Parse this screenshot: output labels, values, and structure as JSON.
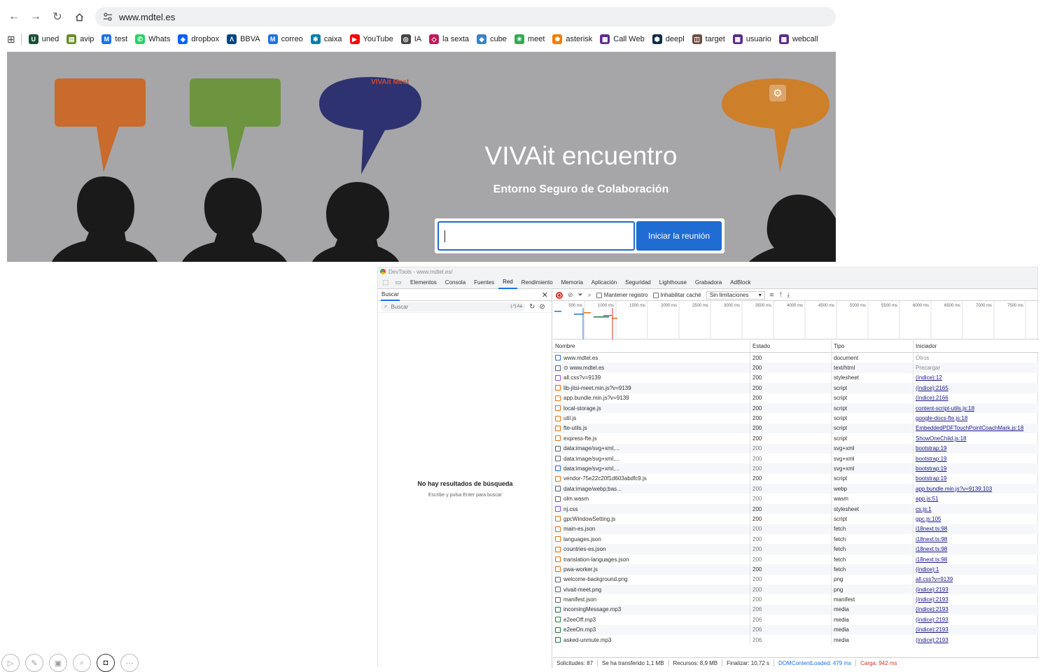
{
  "browser": {
    "url": "www.mdtel.es",
    "bookmarks": [
      {
        "label": "uned",
        "icon": "U",
        "color": "#1a4f35"
      },
      {
        "label": "avip",
        "icon": "▤",
        "color": "#6b8e23"
      },
      {
        "label": "test",
        "icon": "M",
        "color": "#1a73e8"
      },
      {
        "label": "Whats",
        "icon": "✆",
        "color": "#25d366"
      },
      {
        "label": "dropbox",
        "icon": "◈",
        "color": "#0061ff"
      },
      {
        "label": "BBVA",
        "icon": "Λ",
        "color": "#004481"
      },
      {
        "label": "correo",
        "icon": "M",
        "color": "#1a73e8"
      },
      {
        "label": "caixa",
        "icon": "✱",
        "color": "#007eae"
      },
      {
        "label": "YouTube",
        "icon": "▶",
        "color": "#ff0000"
      },
      {
        "label": "IA",
        "icon": "◎",
        "color": "#444444"
      },
      {
        "label": "la sexta",
        "icon": "◇",
        "color": "#c2185b"
      },
      {
        "label": "cube",
        "icon": "◆",
        "color": "#3b82c4"
      },
      {
        "label": "meet",
        "icon": "✳",
        "color": "#34a853"
      },
      {
        "label": "asterisk",
        "icon": "✺",
        "color": "#f57c00"
      },
      {
        "label": "Call Web",
        "icon": "▦",
        "color": "#5b2c8a"
      },
      {
        "label": "deepl",
        "icon": "⬢",
        "color": "#0f2b46"
      },
      {
        "label": "target",
        "icon": "◫",
        "color": "#6d4c41"
      },
      {
        "label": "usuario",
        "icon": "▦",
        "color": "#5b2c8a"
      },
      {
        "label": "webcall",
        "icon": "▦",
        "color": "#5b2c8a"
      }
    ]
  },
  "hero": {
    "title": "VIVAit encuentro",
    "subtitle": "Entorno Seguro de Colaboración",
    "start_button": "Iniciar la reunión",
    "logo_text": "VIVAit Meet"
  },
  "devtools": {
    "window_title": "DevTools - www.mdtel.es/",
    "tabs": [
      "Elementos",
      "Consola",
      "Fuentes",
      "Red",
      "Rendimiento",
      "Memoria",
      "Aplicación",
      "Seguridad",
      "Lighthouse",
      "Grabadora",
      "AdBlock"
    ],
    "active_tab": "Red",
    "search": {
      "tab_label": "Buscar",
      "placeholder": "Buscar",
      "regex_toggle": "(.*) Aa",
      "no_results": "No hay resultados de búsqueda",
      "hint": "Escribe y pulsa Enter para buscar"
    },
    "network": {
      "preserve_log": "Mantener registro",
      "disable_cache": "Inhabilitar caché",
      "throttling": "Sin limitaciones",
      "timeline_ticks": [
        "500 ms",
        "1000 ms",
        "1500 ms",
        "2000 ms",
        "2500 ms",
        "3000 ms",
        "3500 ms",
        "4000 ms",
        "4500 ms",
        "5000 ms",
        "5500 ms",
        "6000 ms",
        "6500 ms",
        "7000 ms",
        "7500 ms"
      ],
      "columns": [
        "Nombre",
        "Estado",
        "Tipo",
        "Iniciador"
      ],
      "rows": [
        {
          "name": "www.mdtel.es",
          "status": "200",
          "type": "document",
          "initiator": "Otros",
          "init_link": false,
          "icon_color": "#1a73e8"
        },
        {
          "name": "⊙ www.mdtel.es",
          "status": "200",
          "type": "text/html",
          "initiator": "Precargar",
          "init_link": false,
          "icon_color": "#5f6368"
        },
        {
          "name": "all.css?v=9139",
          "status": "200",
          "type": "stylesheet",
          "initiator": "(índice):12",
          "init_link": true,
          "icon_color": "#a142f4"
        },
        {
          "name": "lib-jitsi-meet.min.js?v=9139",
          "status": "200",
          "type": "script",
          "initiator": "(índice):2165",
          "init_link": true,
          "icon_color": "#e8710a"
        },
        {
          "name": "app.bundle.min.js?v=9139",
          "status": "200",
          "type": "script",
          "initiator": "(índice):2166",
          "init_link": true,
          "icon_color": "#e8710a"
        },
        {
          "name": "local-storage.js",
          "status": "200",
          "type": "script",
          "initiator": "content-script-utils.js:18",
          "init_link": true,
          "icon_color": "#e8710a"
        },
        {
          "name": "util.js",
          "status": "200",
          "type": "script",
          "initiator": "google-docs-fte.js:18",
          "init_link": true,
          "icon_color": "#e8710a"
        },
        {
          "name": "fte-utils.js",
          "status": "200",
          "type": "script",
          "initiator": "EmbeddedPDFTouchPointCoachMark.js:18",
          "init_link": true,
          "icon_color": "#e8710a"
        },
        {
          "name": "express-fte.js",
          "status": "200",
          "type": "script",
          "initiator": "ShowOneChild.js:18",
          "init_link": true,
          "icon_color": "#e8710a"
        },
        {
          "name": "data:image/svg+xml,...",
          "status": "200",
          "type": "svg+xml",
          "initiator": "bootstrap:19",
          "init_link": true,
          "icon_color": "#5f6368"
        },
        {
          "name": "data:image/svg+xml,...",
          "status": "200",
          "type": "svg+xml",
          "initiator": "bootstrap:19",
          "init_link": true,
          "icon_color": "#5f6368"
        },
        {
          "name": "data:image/svg+xml,...",
          "status": "200",
          "type": "svg+xml",
          "initiator": "bootstrap:19",
          "init_link": true,
          "icon_color": "#1a73e8"
        },
        {
          "name": "vendor-75e22c20f1d603abdfc9.js",
          "status": "200",
          "type": "script",
          "initiator": "bootstrap:19",
          "init_link": true,
          "icon_color": "#e8710a"
        },
        {
          "name": "data:image/webp;bas...",
          "status": "200",
          "type": "webp",
          "initiator": "app.bundle.min.js?v=9139:103",
          "init_link": true,
          "icon_color": "#5f6368"
        },
        {
          "name": "olm.wasm",
          "status": "200",
          "type": "wasm",
          "initiator": "app.js:51",
          "init_link": true,
          "icon_color": "#5f6368"
        },
        {
          "name": "nj.css",
          "status": "200",
          "type": "stylesheet",
          "initiator": "cs.js:1",
          "init_link": true,
          "icon_color": "#a142f4"
        },
        {
          "name": "gpcWindowSetting.js",
          "status": "200",
          "type": "script",
          "initiator": "gpc.js:105",
          "init_link": true,
          "icon_color": "#e8710a"
        },
        {
          "name": "main-es.json",
          "status": "200",
          "type": "fetch",
          "initiator": "i18next.ts:98",
          "init_link": true,
          "icon_color": "#e8710a"
        },
        {
          "name": "languages.json",
          "status": "200",
          "type": "fetch",
          "initiator": "i18next.ts:98",
          "init_link": true,
          "icon_color": "#e8710a"
        },
        {
          "name": "countries-es.json",
          "status": "200",
          "type": "fetch",
          "initiator": "i18next.ts:98",
          "init_link": true,
          "icon_color": "#e8710a"
        },
        {
          "name": "translation-languages.json",
          "status": "200",
          "type": "fetch",
          "initiator": "i18next.ts:98",
          "init_link": true,
          "icon_color": "#e8710a"
        },
        {
          "name": "pwa-worker.js",
          "status": "200",
          "type": "fetch",
          "initiator": "(índice):1",
          "init_link": true,
          "icon_color": "#e8710a"
        },
        {
          "name": "welcome-background.png",
          "status": "200",
          "type": "png",
          "initiator": "all.css?v=9139",
          "init_link": true,
          "icon_color": "#5f6368"
        },
        {
          "name": "vivait-meet.png",
          "status": "200",
          "type": "png",
          "initiator": "(índice):2193",
          "init_link": true,
          "icon_color": "#5f6368"
        },
        {
          "name": "manifest.json",
          "status": "200",
          "type": "manifest",
          "initiator": "(índice):2193",
          "init_link": true,
          "icon_color": "#5f6368"
        },
        {
          "name": "incomingMessage.mp3",
          "status": "206",
          "type": "media",
          "initiator": "(índice):2193",
          "init_link": true,
          "icon_color": "#188038"
        },
        {
          "name": "e2eeOff.mp3",
          "status": "206",
          "type": "media",
          "initiator": "(índice):2193",
          "init_link": true,
          "icon_color": "#188038"
        },
        {
          "name": "e2eeOn.mp3",
          "status": "206",
          "type": "media",
          "initiator": "(índice):2193",
          "init_link": true,
          "icon_color": "#188038"
        },
        {
          "name": "asked-unmute.mp3",
          "status": "206",
          "type": "media",
          "initiator": "(índice):2193",
          "init_link": true,
          "icon_color": "#188038"
        }
      ],
      "status_bar": {
        "requests": "Solicitudes: 87",
        "transferred": "Se ha transferido 1,1 MB",
        "resources": "Recursos: 8,9 MB",
        "finish": "Finalizar: 10,72 s",
        "dom_loaded": "DOMContentLoaded: 479 ms",
        "load": "Carga: 942 ms"
      }
    }
  }
}
